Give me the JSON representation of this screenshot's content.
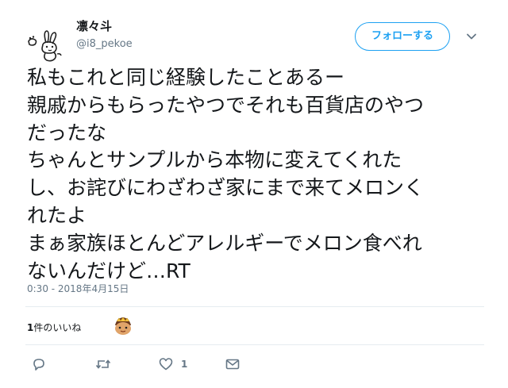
{
  "user": {
    "display_name": "凛々斗",
    "handle": "@i8_pekoe",
    "avatar_icon": "rabbit-doodle-icon"
  },
  "follow_button": {
    "label": "フォローする"
  },
  "menu_caret": {
    "icon": "chevron-down-icon"
  },
  "tweet": {
    "lines": [
      "私もこれと同じ経験したことあるー",
      "親戚からもらったやつでそれも百貨店のやつ",
      "だったな",
      "ちゃんとサンプルから本物に変えてくれた",
      "し、お詫びにわざわざ家にまで来てメロンく",
      "れたよ",
      "まぁ家族ほとんどアレルギーでメロン食べれ",
      "ないんだけど…RT"
    ],
    "timestamp": "0:30 - 2018年4月15日"
  },
  "likes": {
    "count": "1",
    "label_suffix": "件のいいね"
  },
  "actions": {
    "reply_icon": "reply-icon",
    "retweet_icon": "retweet-icon",
    "like_icon": "heart-icon",
    "like_count": "1",
    "dm_icon": "envelope-icon"
  },
  "colors": {
    "accent": "#1da1f2",
    "text": "#14171a",
    "muted": "#657786",
    "divider": "#e6ecf0"
  }
}
